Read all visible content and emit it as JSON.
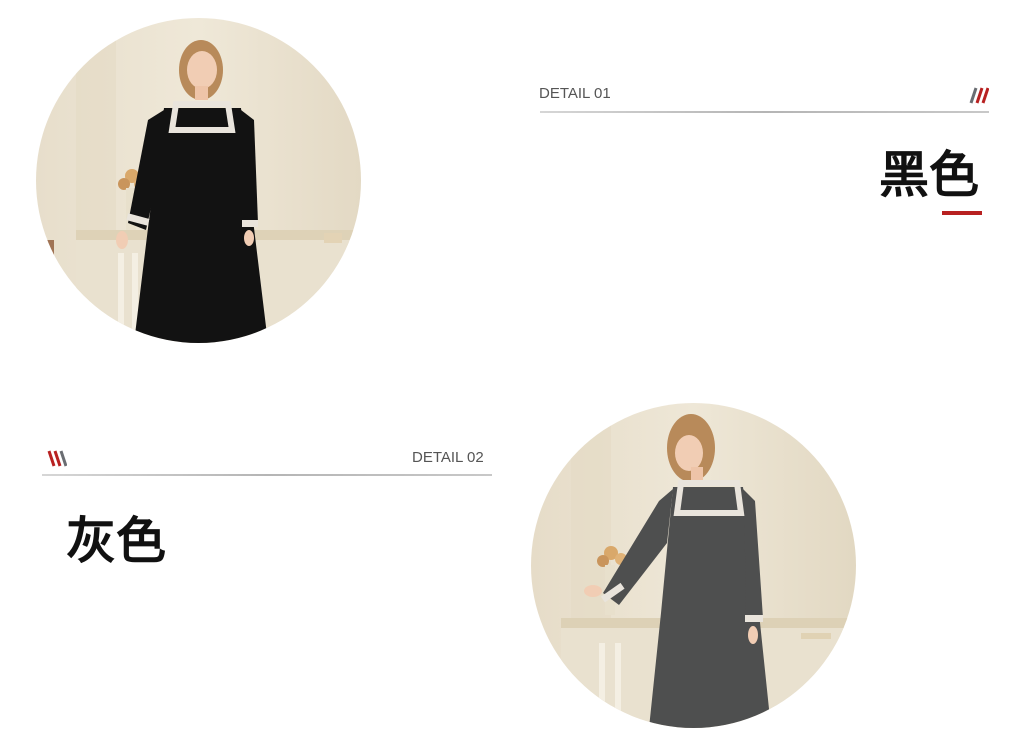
{
  "sections": [
    {
      "detail_label": "DETAIL 01",
      "color_name": "黑色",
      "garment_color": "#121212"
    },
    {
      "detail_label": "DETAIL 02",
      "color_name": "灰色",
      "garment_color": "#4e4f4f"
    }
  ],
  "colors": {
    "accent_red": "#b82121",
    "slash_gray": "#6a6d72",
    "rule_gray": "#b5b5b5",
    "label_gray": "#555555"
  }
}
